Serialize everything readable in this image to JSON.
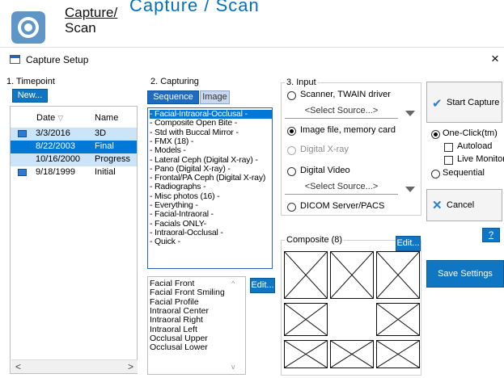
{
  "app": {
    "title_line1": "Capture/",
    "title_line2": "Scan",
    "ghost_title": "Capture / Scan"
  },
  "dialog": {
    "title": "Capture Setup",
    "close_label": "×"
  },
  "timepoint": {
    "group_label": "1. Timepoint",
    "new_button": "New...",
    "col_date": "Date",
    "col_name": "Name",
    "rows": [
      {
        "date": "3/3/2016",
        "name": "3D",
        "icon": "photo-icon",
        "state": "alt"
      },
      {
        "date": "8/22/2003",
        "name": "Final",
        "icon": "",
        "state": "selected"
      },
      {
        "date": "10/16/2000",
        "name": "Progress",
        "icon": "",
        "state": "alt"
      },
      {
        "date": "9/18/1999",
        "name": "Initial",
        "icon": "monitor-icon",
        "state": "none"
      }
    ]
  },
  "capturing": {
    "group_label": "2. Capturing",
    "tab_sequence": "Sequence",
    "tab_image": "Image",
    "sequences": [
      "- Facial-Intraoral-Occlusal -",
      "- Composite Open Bite -",
      "- Std with Buccal Mirror -",
      "- FMX (18) -",
      "- Models -",
      "- Lateral Ceph (Digital X-ray) -",
      "- Pano (Digital X-ray) -",
      "- Frontal/PA Ceph (Digital X-ray)",
      "- Radiographs -",
      "- Misc photos (16) -",
      "- Everything -",
      "- Facial-Intraoral -",
      "- Facials ONLY-",
      "- Intraoral-Occlusal -",
      "- Quick -"
    ],
    "images": [
      "Facial Front",
      "Facial Front Smiling",
      "Facial Profile",
      "Intraoral Center",
      "Intraoral Right",
      "Intraoral Left",
      "Occlusal Upper",
      "Occlusal Lower"
    ],
    "edit_button": "Edit..."
  },
  "input": {
    "group_label": "3. Input",
    "opt_scanner": "Scanner, TWAIN driver",
    "select_source": "<Select Source...>",
    "opt_image_file": "Image file, memory card",
    "opt_digital_xray": "Digital X-ray",
    "opt_digital_video": "Digital Video",
    "opt_dicom": "DICOM Server/PACS"
  },
  "composite": {
    "group_label": "Composite (8)",
    "edit_button": "Edit..."
  },
  "actions": {
    "start_capture": "Start Capture",
    "one_click": "One-Click(tm)",
    "autoload": "Autoload",
    "live_monitor": "Live Monitor",
    "sequential": "Sequential",
    "cancel": "Cancel",
    "help": "?",
    "save_settings": "Save Settings"
  },
  "colors": {
    "accent": "#0078d7",
    "button_blue": "#0f76c3",
    "tab_blue": "#2c62b4"
  }
}
